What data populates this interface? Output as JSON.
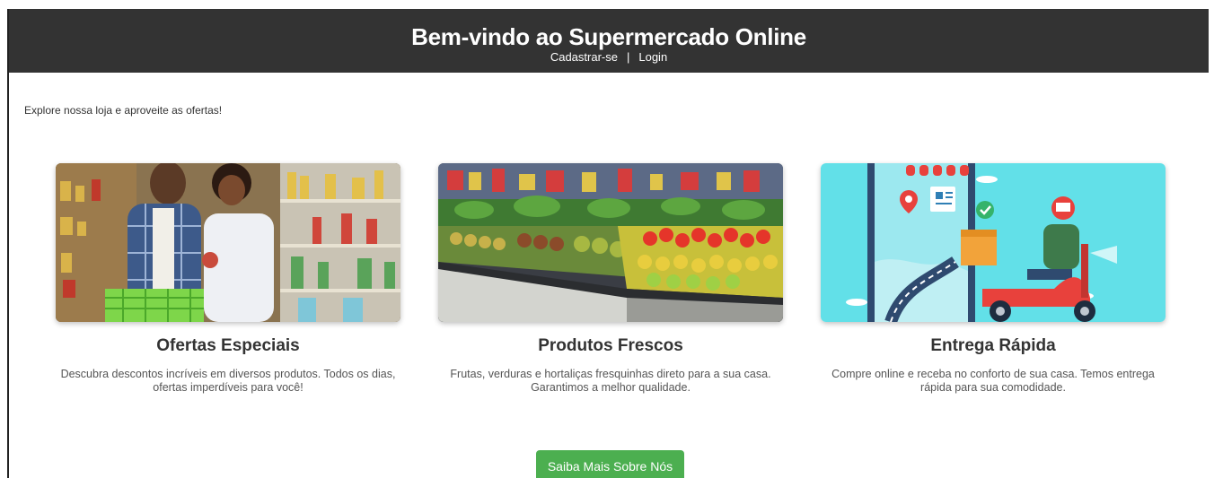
{
  "header": {
    "title": "Bem-vindo ao Supermercado Online",
    "nav": {
      "signup": "Cadastrar-se",
      "separator": "|",
      "login": "Login"
    }
  },
  "intro": "Explore nossa loja e aproveite as ofertas!",
  "cards": [
    {
      "image": "couple-shopping-supermarket-photo",
      "title": "Ofertas Especiais",
      "description": "Descubra descontos incríveis em diversos produtos. Todos os dias, ofertas imperdíveis para você!"
    },
    {
      "image": "fresh-produce-aisle-photo",
      "title": "Produtos Frescos",
      "description": "Frutas, verduras e hortaliças fresquinhas direto para a sua casa. Garantimos a melhor qualidade."
    },
    {
      "image": "scooter-delivery-illustration",
      "title": "Entrega Rápida",
      "description": "Compre online e receba no conforto de sua casa. Temos entrega rápida para sua comodidade."
    }
  ],
  "cta": {
    "label": "Saiba Mais Sobre Nós"
  },
  "colors": {
    "header_bg": "#333333",
    "cta_bg": "#4caf50",
    "delivery_bg": "#62e0e8"
  }
}
